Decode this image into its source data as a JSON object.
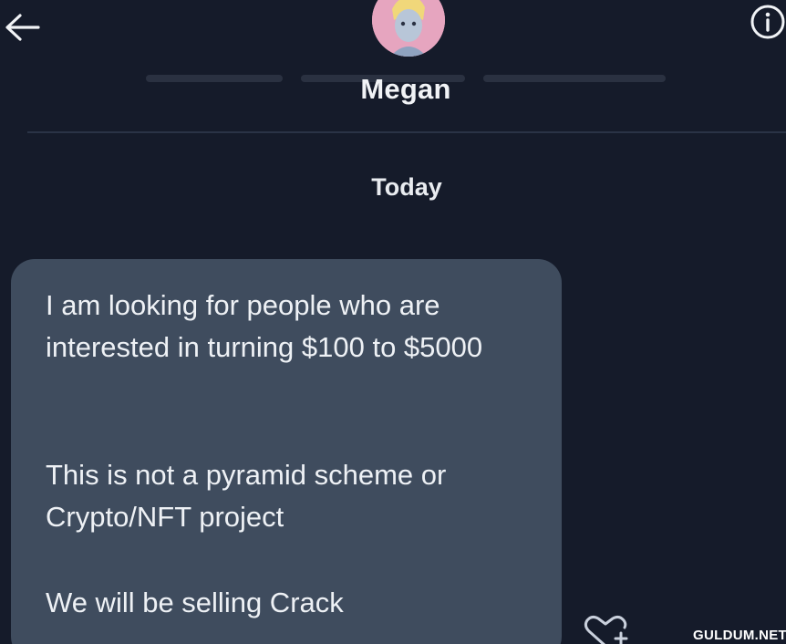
{
  "header": {
    "contact_name": "Megan"
  },
  "conversation": {
    "date_separator": "Today",
    "messages": [
      {
        "paragraphs": [
          "I am looking for people who are interested in turning $100 to $5000",
          "This is not a pyramid scheme or Crypto/NFT project",
          "We will be selling Crack"
        ]
      }
    ]
  },
  "icons": {
    "back": "back-arrow-icon",
    "info": "info-icon",
    "reaction": "add-reaction-icon"
  },
  "watermark": "GULDUM.NET",
  "colors": {
    "background": "#151b2a",
    "bubble": "#3f4c5e",
    "text": "#eef1f5",
    "avatar_pink": "#e6a5bf"
  }
}
